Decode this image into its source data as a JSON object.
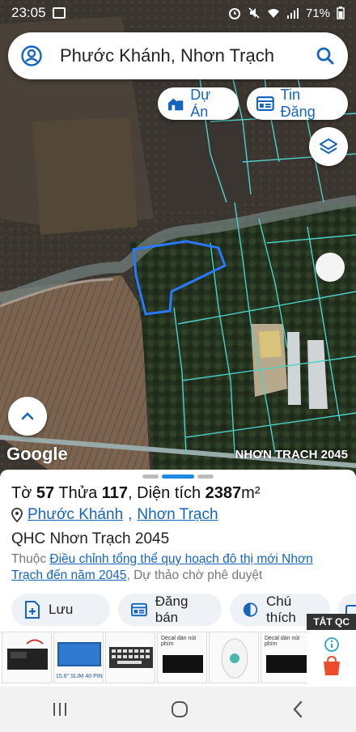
{
  "status_bar": {
    "time": "23:05",
    "battery": "71%"
  },
  "search": {
    "query": "Phước Khánh, Nhơn Trạch"
  },
  "map_buttons": {
    "du_an": "Dự Án",
    "tin_dang": "Tin Đăng"
  },
  "map_overlay": {
    "google": "Google",
    "plan_label": "NHƠN TRẠCH 2045"
  },
  "parcel": {
    "to_label": "Tờ",
    "to": "57",
    "thua_label": "Thửa",
    "thua": "117",
    "area_label": "Diện tích",
    "area": "2387",
    "area_unit": "m²",
    "ward": "Phước Khánh",
    "district": "Nhơn Trạch",
    "plan_name": "QHC Nhơn Trạch 2045",
    "plan_prefix": "Thuộc",
    "plan_link": "Điều chỉnh tổng thể quy hoạch đô thị mới Nhơn Trạch đến năm 2045",
    "plan_status": ", Dự thảo chờ phê duyệt"
  },
  "actions": {
    "save": "Lưu",
    "sell": "Đăng bán",
    "legend": "Chú thích"
  },
  "ad": {
    "close": "TẮT QC",
    "items": [
      {
        "caption": ""
      },
      {
        "caption": "15.6\" SLIM 40 PIN"
      },
      {
        "caption": ""
      },
      {
        "caption": "Decal dán nút phím"
      },
      {
        "caption": ""
      },
      {
        "caption": "Decal dán nút phím"
      }
    ]
  },
  "colors": {
    "accent": "#1565c0",
    "parcel_outline": "#2979ff",
    "plot_lines": "#4dd0c8"
  }
}
